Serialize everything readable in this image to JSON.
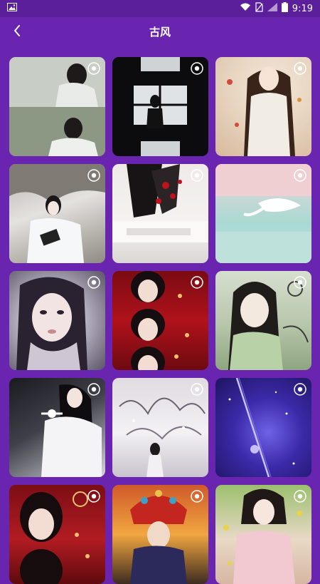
{
  "status_bar": {
    "time": "9:19",
    "icons": [
      "image-icon",
      "wifi-icon",
      "no-sim-icon",
      "signal-icon",
      "battery-icon"
    ]
  },
  "header": {
    "title": "古风",
    "back_icon": "back-arrow-icon"
  },
  "colors": {
    "background": "#6a25b0",
    "status_bar": "#5c1f9c",
    "text": "#ffffff"
  },
  "grid": {
    "items": [
      {
        "id": "1",
        "badge_icon": "live-wallpaper-icon"
      },
      {
        "id": "2",
        "badge_icon": "live-wallpaper-icon"
      },
      {
        "id": "3",
        "badge_icon": "live-wallpaper-icon"
      },
      {
        "id": "4",
        "badge_icon": "live-wallpaper-icon"
      },
      {
        "id": "5",
        "badge_icon": "live-wallpaper-icon"
      },
      {
        "id": "6",
        "badge_icon": "live-wallpaper-icon"
      },
      {
        "id": "7",
        "badge_icon": "live-wallpaper-icon"
      },
      {
        "id": "8",
        "badge_icon": "live-wallpaper-icon"
      },
      {
        "id": "9",
        "badge_icon": "live-wallpaper-icon"
      },
      {
        "id": "10",
        "badge_icon": "live-wallpaper-icon"
      },
      {
        "id": "11",
        "badge_icon": "live-wallpaper-icon"
      },
      {
        "id": "12",
        "badge_icon": "live-wallpaper-icon"
      },
      {
        "id": "13",
        "badge_icon": "live-wallpaper-icon"
      },
      {
        "id": "14",
        "badge_icon": "live-wallpaper-icon"
      },
      {
        "id": "15",
        "badge_icon": "live-wallpaper-icon"
      }
    ]
  }
}
